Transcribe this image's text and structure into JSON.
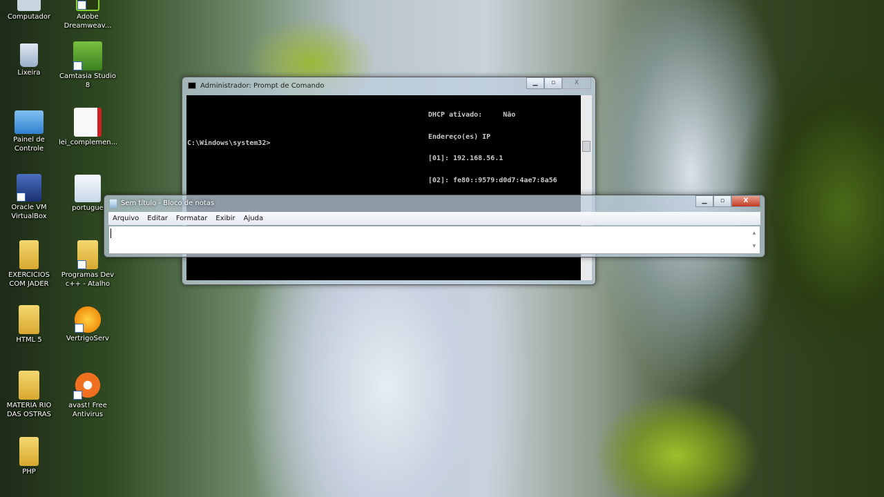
{
  "desktop_icons": [
    {
      "label": "Computador",
      "col": 1
    },
    {
      "label": "Adobe Dreamweav...",
      "col": 2
    },
    {
      "label": "Lixeira"
    },
    {
      "label": "Camtasia Studio 8"
    },
    {
      "label": "Painel de Controle"
    },
    {
      "label": "lei_complemen..."
    },
    {
      "label": "Oracle VM VirtualBox"
    },
    {
      "label": "portugue"
    },
    {
      "label": "EXERCICIOS COM JADER"
    },
    {
      "label": "Programas Dev c++ - Atalho"
    },
    {
      "label": "HTML 5"
    },
    {
      "label": "VertrigoServ"
    },
    {
      "label": "MATERIA RIO DAS OSTRAS"
    },
    {
      "label": "avast! Free Antivirus"
    },
    {
      "label": "PHP"
    }
  ],
  "cmd": {
    "title": "Administrador: Prompt de Comando",
    "lines": [
      "DHCP ativado:     Não",
      "Endereço(es) IP",
      "[01]: 192.168.56.1",
      "[02]: fe80::9579:d0d7:4ae7:8a56"
    ],
    "prompt": "C:\\Windows\\system32>"
  },
  "notepad": {
    "title": "Sem título - Bloco de notas",
    "menu": [
      "Arquivo",
      "Editar",
      "Formatar",
      "Exibir",
      "Ajuda"
    ],
    "text": ""
  },
  "controls": {
    "minimize": "▁",
    "maximize": "▫",
    "close": "X"
  }
}
